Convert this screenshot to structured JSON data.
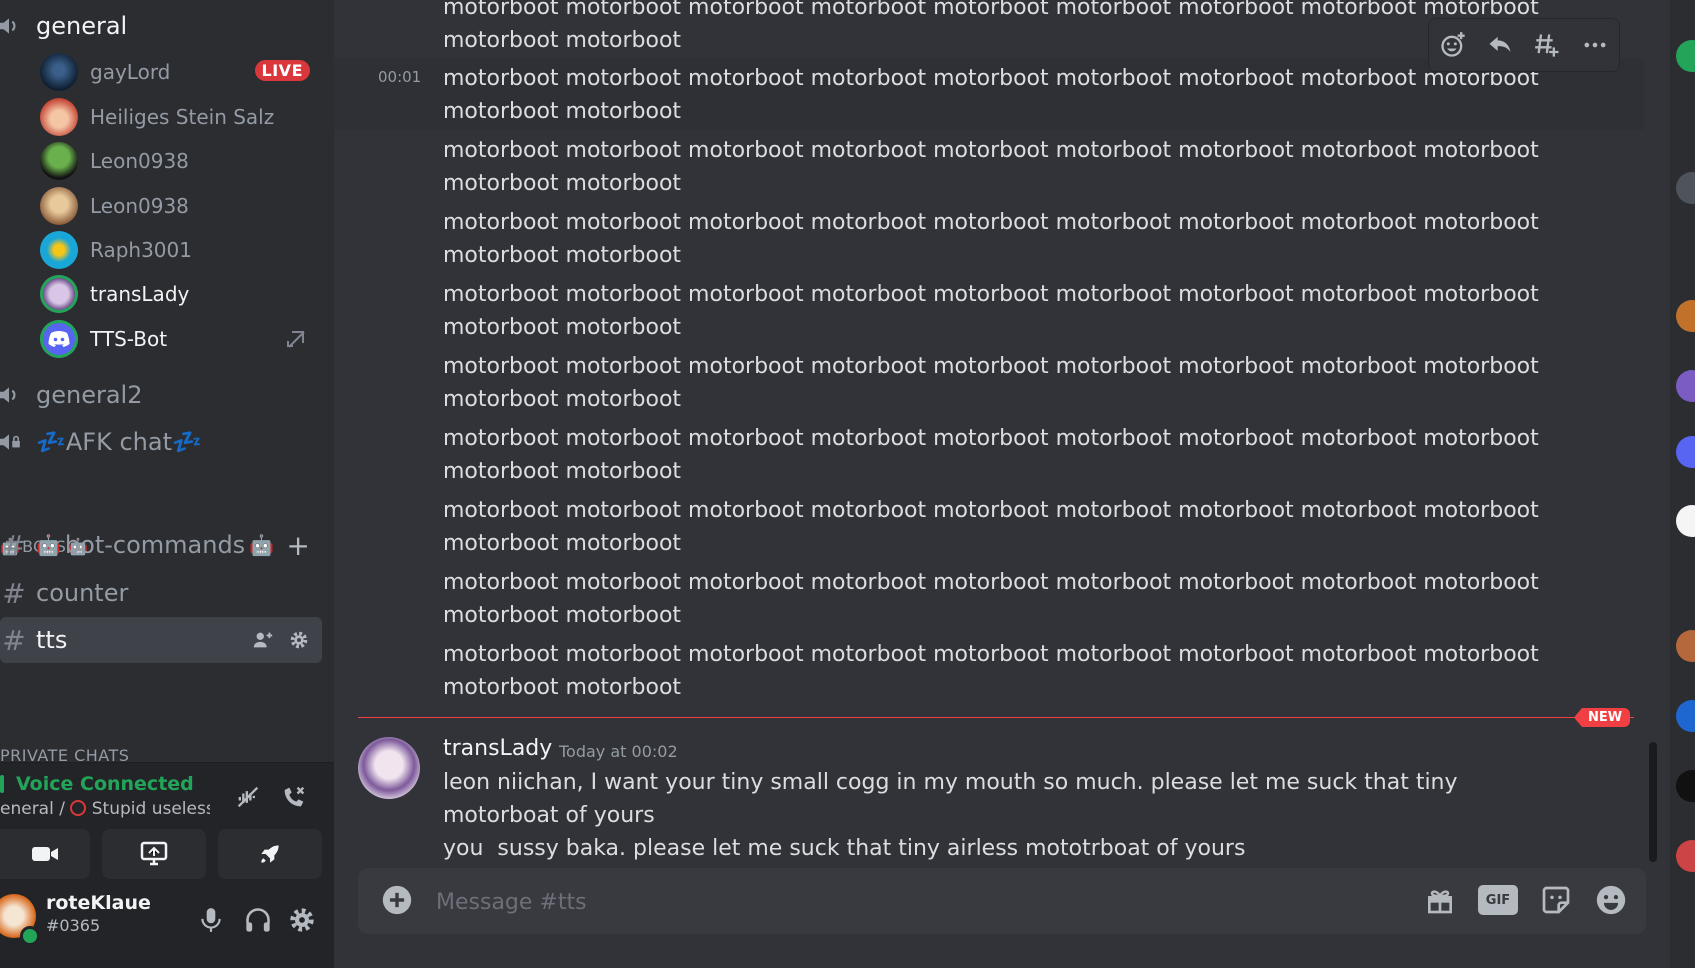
{
  "sidebar": {
    "voice_channel": "general",
    "members": [
      {
        "name": "gayLord",
        "badge": "LIVE"
      },
      {
        "name": "Heiliges Stein Salz"
      },
      {
        "name": "Leon0938"
      },
      {
        "name": "Leon0938"
      },
      {
        "name": "Raph3001"
      },
      {
        "name": "transLady"
      },
      {
        "name": "TTS-Bot"
      }
    ],
    "voice_channel_2": "general2",
    "afk_channel": "💤AFK chat💤",
    "category_bots": "BOTS",
    "text_channels": [
      {
        "name": "bot-commands"
      },
      {
        "name": "counter"
      },
      {
        "name": "tts"
      }
    ],
    "category_private": "PRIVATE CHATS"
  },
  "voice_panel": {
    "status": "Voice Connected",
    "location": "eneral / ",
    "location_channel": "Stupid useless ..."
  },
  "user_panel": {
    "username": "roteKlaue",
    "discriminator": "#0365"
  },
  "chat": {
    "repeated_line_1": "motorboot motorboot motorboot motorboot motorboot motorboot motorboot motorboot motorboot",
    "repeated_line_2": "motorboot motorboot",
    "hover_timestamp": "00:01",
    "new_badge": "NEW",
    "last_message": {
      "author": "transLady",
      "time": "Today at 00:02",
      "line1": "leon niichan, I want your tiny small cogg in my mouth so much. please let me suck that tiny motorboat of yours",
      "line2": "you  sussy baka. please let me suck that tiny airless mototrboat of yours"
    },
    "composer_placeholder": "Message #tts",
    "gif_label": "GIF"
  },
  "colors": {
    "accent_green": "#23a559",
    "live_red": "#da373c",
    "new_red": "#f23f43"
  }
}
